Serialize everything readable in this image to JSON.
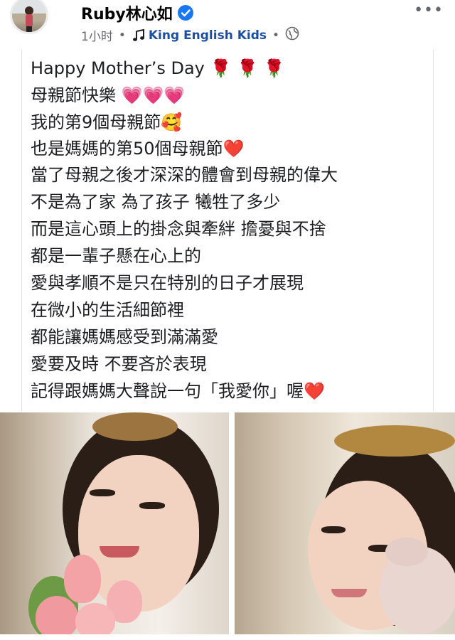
{
  "header": {
    "name": "Ruby林心如",
    "time": "1小时",
    "group": "King English Kids",
    "separator": "•"
  },
  "icons": {
    "verified": "verified-badge-icon",
    "more": "more-options-icon",
    "music": "music-note-icon",
    "globe": "globe-icon"
  },
  "post": {
    "lines": [
      "Happy Mother’s Day 🌹 🌹 🌹",
      "母親節快樂 💗💗💗",
      "我的第9個母親節🥰",
      "也是媽媽的第50個母親節❤️",
      "當了母親之後才深深的體會到母親的偉大",
      "不是為了家  為了孩子  犧牲了多少",
      "而是這心頭上的掛念與牽絆   擔憂與不捨",
      "都是一輩子懸在心上的",
      "愛與孝順不是只在特別的日子才展現",
      "在微小的生活細節裡",
      "都能讓媽媽感受到滿滿愛",
      "愛要及時  不要吝於表現",
      "記得跟媽媽大聲說一句「我愛你」喔❤️"
    ]
  },
  "colors": {
    "link": "#1b4fa6",
    "meta": "#65676b",
    "verified": "#1877f2"
  }
}
